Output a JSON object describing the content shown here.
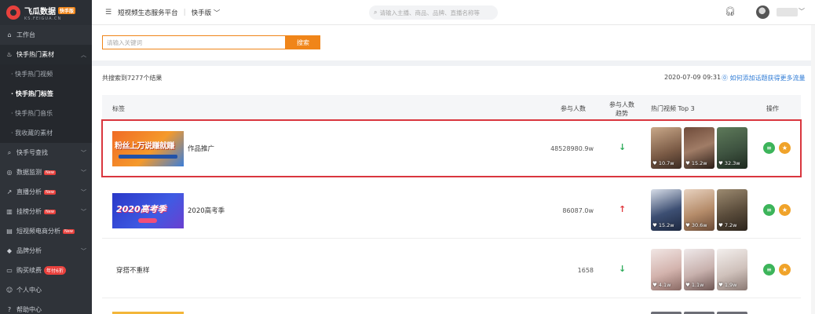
{
  "app": {
    "logo_title": "飞瓜数据",
    "logo_badge": "快手版",
    "logo_sub": "KS.FEIGUA.CN"
  },
  "header": {
    "platform": "短视频生态服务平台",
    "switch_label": "快手版",
    "search_placeholder": "请输入主播、商品、品牌、直播名称等"
  },
  "sidebar": {
    "items": [
      {
        "label": "工作台",
        "icon": "home-icon"
      },
      {
        "label": "快手热门素材",
        "icon": "fire-icon"
      },
      {
        "label": "快手号查找",
        "icon": "search-icon"
      },
      {
        "label": "数据监测",
        "icon": "monitor-icon",
        "badge": "New"
      },
      {
        "label": "直播分析",
        "icon": "chart-icon",
        "badge": "New"
      },
      {
        "label": "挂榜分析",
        "icon": "rank-icon",
        "badge": "New"
      },
      {
        "label": "短视频电商分析",
        "icon": "cart-icon",
        "badge": "New"
      },
      {
        "label": "品牌分析",
        "icon": "diamond-icon"
      },
      {
        "label": "购买续费",
        "icon": "card-icon",
        "badge": "年付6折"
      },
      {
        "label": "个人中心",
        "icon": "user-icon"
      },
      {
        "label": "帮助中心",
        "icon": "help-icon"
      }
    ],
    "sub_items": [
      {
        "label": "· 快手热门视频"
      },
      {
        "label": "· 快手热门标签"
      },
      {
        "label": "· 快手热门音乐"
      },
      {
        "label": "· 我收藏的素材"
      }
    ]
  },
  "search": {
    "placeholder": "请输入关键词",
    "button": "搜索"
  },
  "results": {
    "count_text": "共搜索到7277个结果",
    "date": "2020-07-09 09:31",
    "help_link": "⓪ 如何添加话题获得更多流量"
  },
  "table": {
    "headers": {
      "tag": "标签",
      "participants": "参与人数",
      "trend_line1": "参与人数",
      "trend_line2": "趋势",
      "hot_videos": "热门视频 Top 3",
      "ops": "操作"
    },
    "rows": [
      {
        "banner_text": "粉丝上万说赚就赚",
        "tag": "作品推广",
        "count": "48528980.9w",
        "trend": "↓",
        "likes": [
          "10.7w",
          "15.2w",
          "32.3w"
        ]
      },
      {
        "banner_text": "2020高考季",
        "tag": "2020高考季",
        "count": "86087.0w",
        "trend": "↑",
        "likes": [
          "15.2w",
          "30.6w",
          "7.2w"
        ]
      },
      {
        "banner_text": "",
        "tag": "穿搭不重样",
        "count": "1658",
        "trend": "↓",
        "likes": [
          "4.1w",
          "1.1w",
          "1.9w"
        ]
      }
    ]
  },
  "colors": {
    "accent": "#f08519",
    "sidebar_bg": "#2f3339",
    "highlight": "#d9363e",
    "trend_down": "#2dab5a",
    "trend_up": "#e0393e",
    "link": "#2e7bd6"
  }
}
